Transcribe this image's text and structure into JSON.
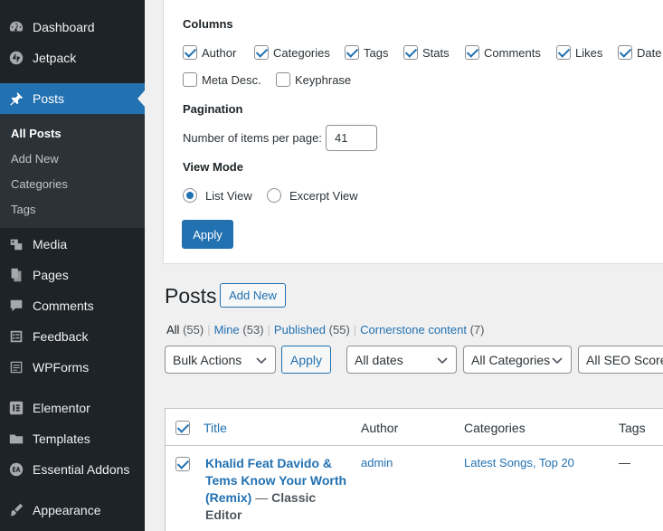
{
  "sidebar": {
    "items": [
      {
        "label": "Dashboard",
        "icon": "dashboard-icon"
      },
      {
        "label": "Jetpack",
        "icon": "jetpack-icon"
      },
      {
        "label": "Posts",
        "icon": "pin-icon"
      },
      {
        "label": "Media",
        "icon": "media-icon"
      },
      {
        "label": "Pages",
        "icon": "pages-icon"
      },
      {
        "label": "Comments",
        "icon": "comment-icon"
      },
      {
        "label": "Feedback",
        "icon": "feedback-icon"
      },
      {
        "label": "WPForms",
        "icon": "wpforms-icon"
      },
      {
        "label": "Elementor",
        "icon": "elementor-icon"
      },
      {
        "label": "Templates",
        "icon": "folder-icon"
      },
      {
        "label": "Essential Addons",
        "icon": "essential-addons-icon"
      },
      {
        "label": "Appearance",
        "icon": "brush-icon"
      }
    ],
    "submenu": [
      "All Posts",
      "Add New",
      "Categories",
      "Tags"
    ]
  },
  "screen_options": {
    "columns_heading": "Columns",
    "columns": [
      {
        "label": "Author",
        "checked": true
      },
      {
        "label": "Categories",
        "checked": true
      },
      {
        "label": "Tags",
        "checked": true
      },
      {
        "label": "Stats",
        "checked": true
      },
      {
        "label": "Comments",
        "checked": true
      },
      {
        "label": "Likes",
        "checked": true
      },
      {
        "label": "Date",
        "checked": true
      },
      {
        "label": "Meta Desc.",
        "checked": false
      },
      {
        "label": "Keyphrase",
        "checked": false
      }
    ],
    "pagination_heading": "Pagination",
    "per_page_label": "Number of items per page:",
    "per_page_value": "41",
    "view_mode_heading": "View Mode",
    "view_modes": [
      {
        "label": "List View",
        "checked": true
      },
      {
        "label": "Excerpt View",
        "checked": false
      }
    ],
    "apply_label": "Apply"
  },
  "page": {
    "title": "Posts",
    "add_new": "Add New"
  },
  "filters": {
    "links": [
      {
        "label": "All",
        "count": "(55)"
      },
      {
        "label": "Mine",
        "count": "(53)"
      },
      {
        "label": "Published",
        "count": "(55)"
      },
      {
        "label": "Cornerstone content",
        "count": "(7)"
      }
    ],
    "separator": "|",
    "bulk_actions": "Bulk Actions",
    "apply": "Apply",
    "dates": "All dates",
    "categories": "All Categories",
    "seo": "All SEO Scores"
  },
  "table": {
    "headers": {
      "title": "Title",
      "author": "Author",
      "categories": "Categories",
      "tags": "Tags"
    },
    "rows": [
      {
        "title": "Khalid Feat Davido & Tems Know Your Worth (Remix)",
        "state_dash": "—",
        "state": "Classic Editor",
        "author": "admin",
        "categories": "Latest Songs, Top 20",
        "tags": "—"
      }
    ]
  },
  "colors": {
    "accent": "#2271b1",
    "sidebar_bg": "#1d2327",
    "submenu_bg": "#2c3338"
  }
}
